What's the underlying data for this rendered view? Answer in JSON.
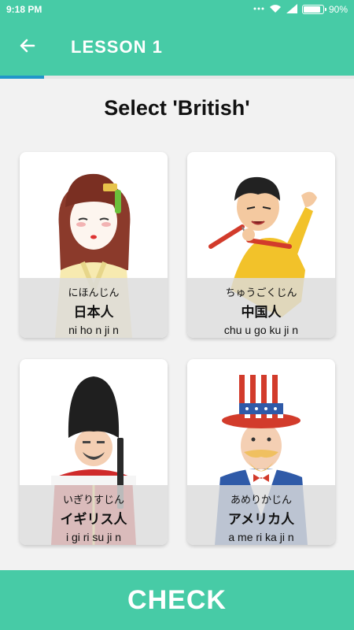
{
  "status_bar": {
    "time": "9:18 PM",
    "battery_text": "90%",
    "battery_level": 0.9,
    "icons": [
      "dots-icon",
      "wifi-icon",
      "signal-icon",
      "battery-icon"
    ]
  },
  "header": {
    "back_icon": "arrow-left-icon",
    "title": "LESSON 1",
    "progress": 0.125
  },
  "prompt": "Select 'British'",
  "options": [
    {
      "kana": "にほんじん",
      "kanji": "日本人",
      "romaji": "ni ho n ji n"
    },
    {
      "kana": "ちゅうごくじん",
      "kanji": "中国人",
      "romaji": "chu u go ku ji n"
    },
    {
      "kana": "いぎりすじん",
      "kanji": "イギリス人",
      "romaji": "i gi ri su ji n"
    },
    {
      "kana": "あめりかじん",
      "kanji": "アメリカ人",
      "romaji": "a me ri ka ji n"
    }
  ],
  "footer": {
    "check_label": "CHECK"
  },
  "colors": {
    "primary": "#47cba6",
    "progress": "#2196c9"
  }
}
